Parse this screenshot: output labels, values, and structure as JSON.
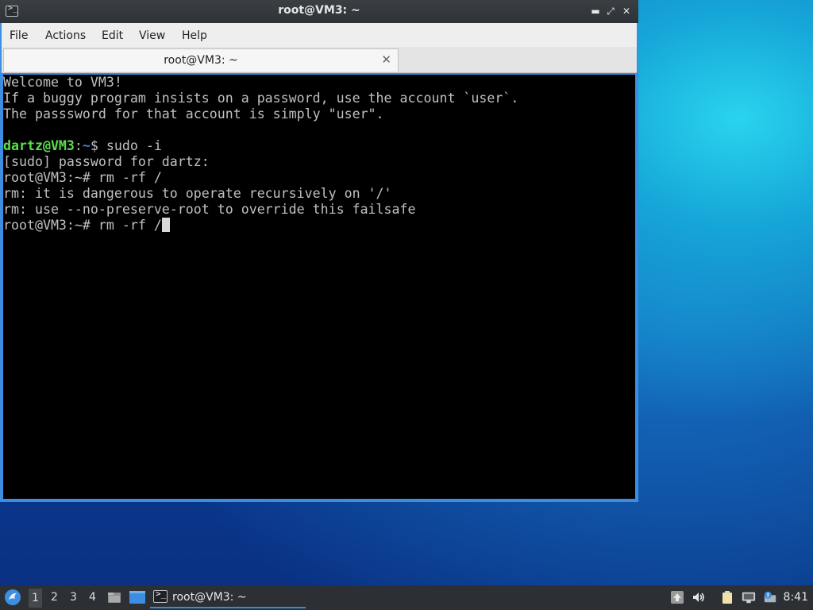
{
  "window": {
    "title": "root@VM3: ~",
    "controls": {
      "minimize": "▬",
      "maximize": "⤢",
      "close": "✕"
    }
  },
  "menubar": {
    "items": [
      "File",
      "Actions",
      "Edit",
      "View",
      "Help"
    ]
  },
  "tabs": [
    {
      "label": "root@VM3: ~",
      "close": "✕"
    }
  ],
  "terminal": {
    "lines": [
      {
        "text": "Welcome to VM3!"
      },
      {
        "text": "If a buggy program insists on a password, use the account `user`."
      },
      {
        "text": "The passsword for that account is simply \"user\"."
      },
      {
        "text": ""
      },
      {
        "prompt_user": "dartz@VM3",
        "prompt_sep": ":",
        "prompt_path": "~",
        "prompt_end": "$ ",
        "command": "sudo -i"
      },
      {
        "text": "[sudo] password for dartz:"
      },
      {
        "text": "root@VM3:~# rm -rf /"
      },
      {
        "text": "rm: it is dangerous to operate recursively on '/'"
      },
      {
        "text": "rm: use --no-preserve-root to override this failsafe"
      },
      {
        "text": "root@VM3:~# rm -rf /",
        "cursor": true
      }
    ]
  },
  "taskbar": {
    "workspaces": [
      "1",
      "2",
      "3",
      "4"
    ],
    "active_workspace": "1",
    "task_label": "root@VM3: ~",
    "clock": "8:41"
  },
  "icons": {
    "start": "lxqt-start-menu-icon",
    "file_manager": "file-manager-icon",
    "show_desktop": "show-desktop-icon",
    "terminal": "terminal-icon",
    "updates": "updates-icon",
    "volume": "volume-icon",
    "clipboard": "clipboard-icon",
    "network": "network-icon",
    "notifications": "notification-icon"
  },
  "colors": {
    "prompt_user": "#5adf4a",
    "prompt_path": "#3f7fd8",
    "window_border": "#3d8ee0",
    "taskbar": "#2c3035"
  }
}
